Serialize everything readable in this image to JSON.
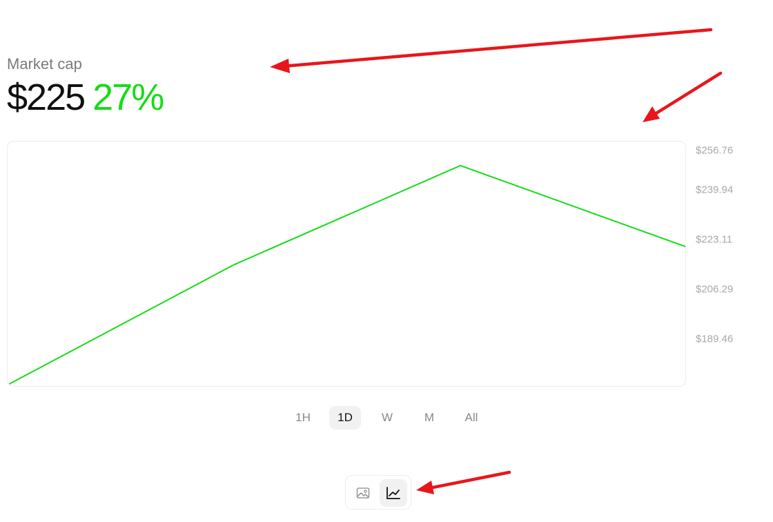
{
  "header": {
    "label": "Market cap",
    "price": "$225",
    "change": "27%"
  },
  "chart_data": {
    "type": "line",
    "title": "",
    "xlabel": "",
    "ylabel": "",
    "y_tick_labels": [
      "$256.76",
      "$239.94",
      "$223.11",
      "$206.29",
      "$189.46"
    ],
    "y_ticks": [
      256.76,
      239.94,
      223.11,
      206.29,
      189.46
    ],
    "ylim": [
      173,
      262
    ],
    "series": [
      {
        "color": "#16dc16",
        "values": [
          173.9,
          217.4,
          253.3,
          223.8
        ]
      }
    ],
    "x": [
      0,
      1,
      2,
      3
    ],
    "grid": false
  },
  "ranges": [
    {
      "label": "1H",
      "active": false
    },
    {
      "label": "1D",
      "active": true
    },
    {
      "label": "W",
      "active": false
    },
    {
      "label": "M",
      "active": false
    },
    {
      "label": "All",
      "active": false
    }
  ],
  "view_toggle": {
    "items": [
      {
        "icon": "image-icon",
        "active": false
      },
      {
        "icon": "line-chart-icon",
        "active": true
      }
    ]
  },
  "colors": {
    "positive": "#16dc16",
    "annotation_arrow": "#e8161b"
  }
}
